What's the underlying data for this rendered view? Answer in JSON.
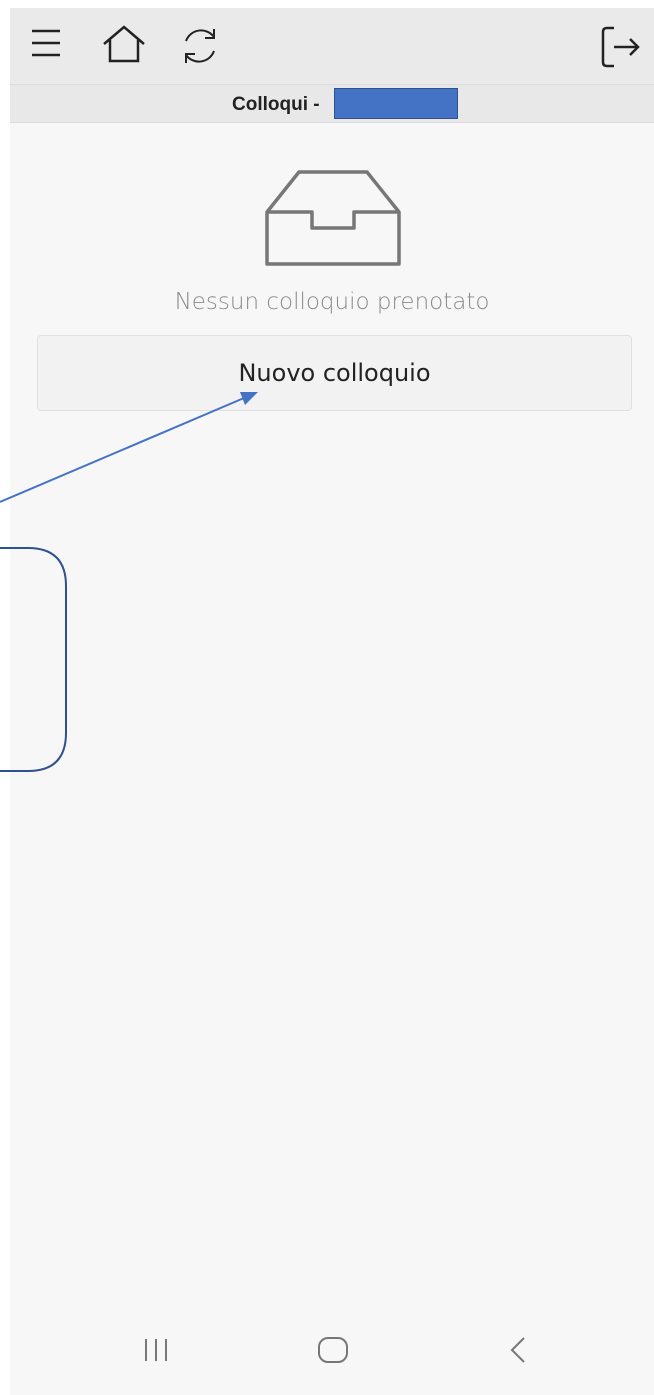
{
  "header": {
    "title": "Colloqui -",
    "icons": [
      "menu-icon",
      "home-icon",
      "refresh-icon",
      "logout-icon"
    ]
  },
  "main": {
    "empty_icon": "inbox-icon",
    "empty_message": "Nessun colloquio prenotato",
    "new_button_label": "Nuovo colloquio"
  },
  "system_nav": {
    "icons": [
      "recent-apps-icon",
      "home-nav-icon",
      "back-icon"
    ]
  },
  "colors": {
    "redaction": "#4472c4",
    "annotation": "#4472c4",
    "callout_border": "#2f528f"
  }
}
